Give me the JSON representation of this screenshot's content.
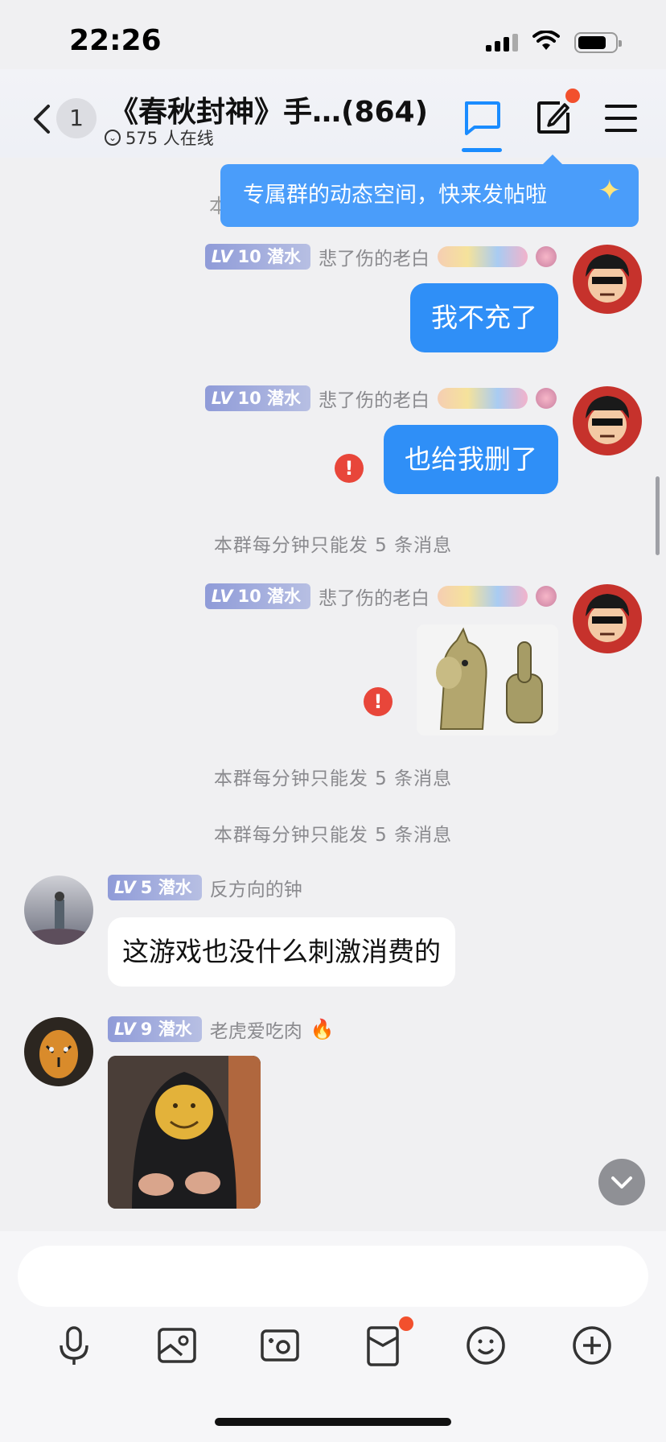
{
  "status_bar": {
    "time": "22:26"
  },
  "header": {
    "unread_count": "1",
    "title": "《春秋封神》手…(864)",
    "online_text": "575 人在线"
  },
  "tooltip": {
    "text": "专属群的动态空间，快来发帖啦"
  },
  "hidden_system_text": "本",
  "messages": [
    {
      "type": "self_text",
      "level": "10",
      "role": "潜水",
      "nickname": "悲了伤的老白",
      "text": "我不充了",
      "failed": false
    },
    {
      "type": "self_text",
      "level": "10",
      "role": "潜水",
      "nickname": "悲了伤的老白",
      "text": "也给我删了",
      "failed": true
    },
    {
      "type": "system",
      "text": "本群每分钟只能发 5 条消息"
    },
    {
      "type": "self_image",
      "level": "10",
      "role": "潜水",
      "nickname": "悲了伤的老白",
      "image": "horse-thumbs-up-sticker",
      "failed": true
    },
    {
      "type": "system",
      "text": "本群每分钟只能发 5 条消息"
    },
    {
      "type": "system",
      "text": "本群每分钟只能发 5 条消息"
    },
    {
      "type": "other_text",
      "level": "5",
      "role": "潜水",
      "nickname": "反方向的钟",
      "text": "这游戏也没什么刺激消费的"
    },
    {
      "type": "other_image",
      "level": "9",
      "role": "潜水",
      "nickname": "老虎爱吃肉",
      "image": "hooded-smiley-clapping-sticker"
    }
  ],
  "lv_prefix": "LV",
  "toolbar": [
    "microphone-icon",
    "image-icon",
    "camera-icon",
    "red-packet-icon",
    "emoji-icon",
    "plus-icon"
  ],
  "colors": {
    "accent": "#2f8ff7",
    "tooltip": "#4a9dfa",
    "error": "#e8463a",
    "badge_dot": "#f2502d"
  }
}
